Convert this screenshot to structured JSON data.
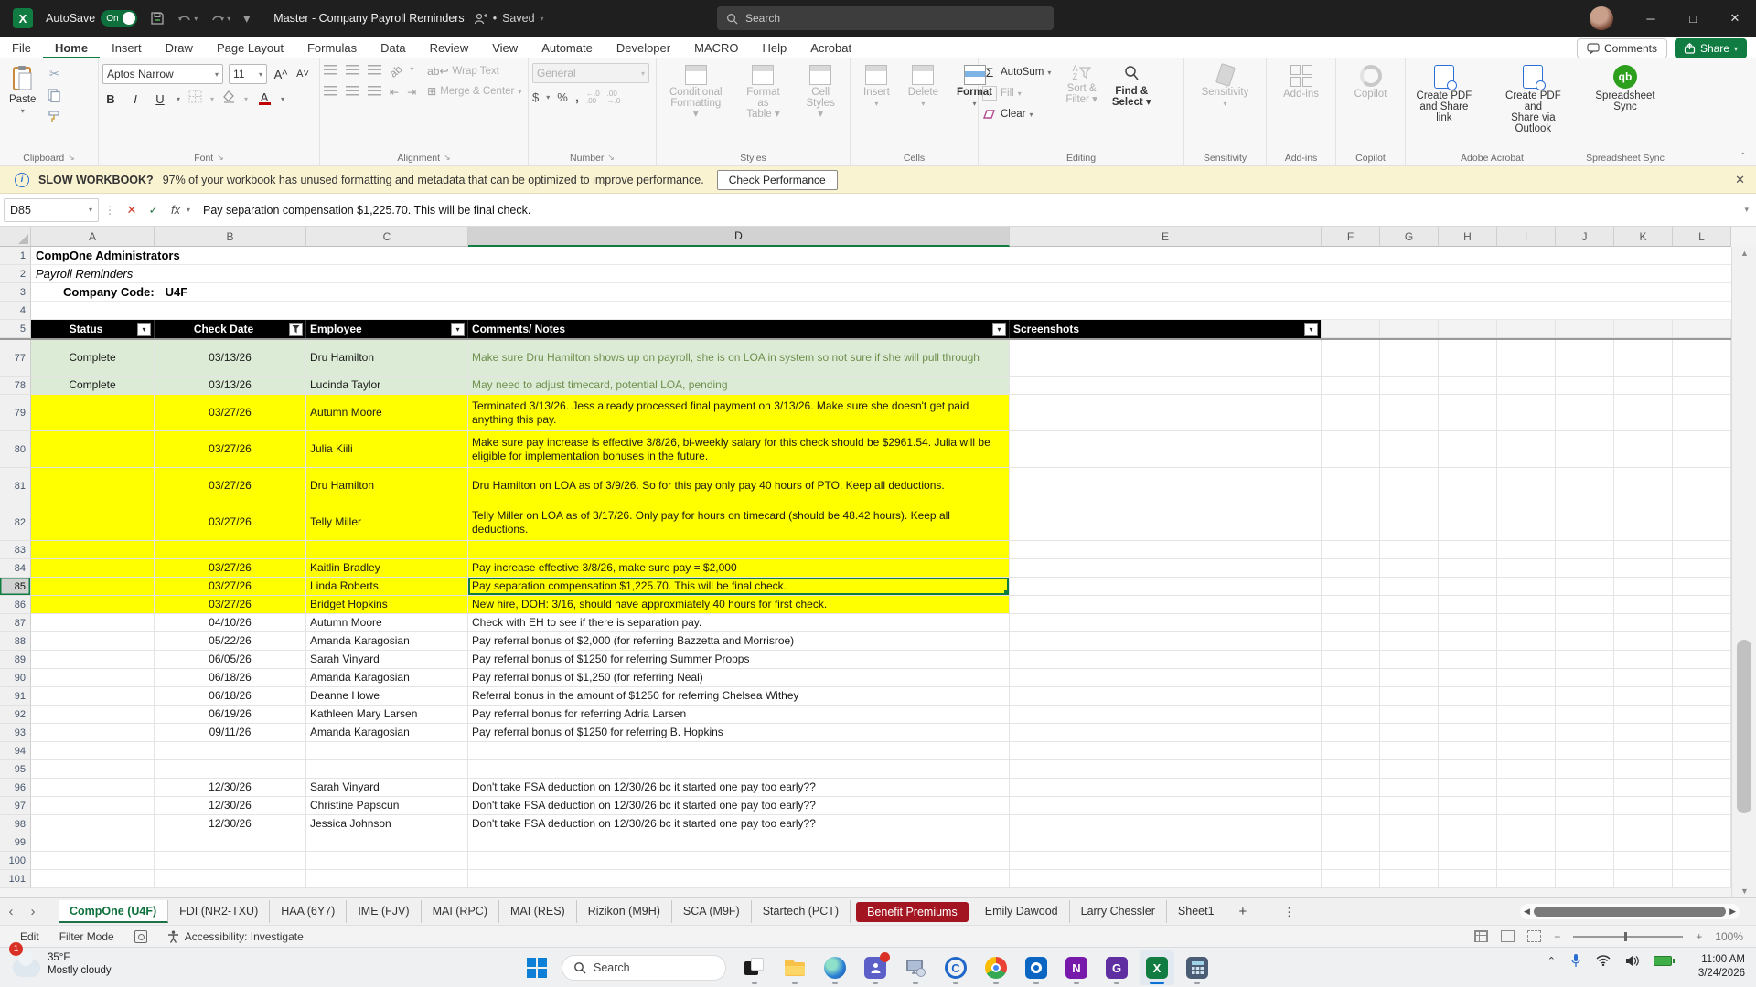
{
  "colors": {
    "accent_green": "#107C41",
    "header_black": "#000000",
    "row_green": "#DCEBD5",
    "row_yellow": "#FFFF00",
    "tab_red": "#A31621",
    "warning_bg": "#FAF3D1",
    "taskbar_accent": "#0a6fd4"
  },
  "titlebar": {
    "autosave": "AutoSave",
    "autosave_state": "On",
    "title": "Master - Company Payroll Reminders",
    "saved": "Saved",
    "search_placeholder": "Search",
    "window_buttons": {
      "minimize": "─",
      "maximize": "□",
      "close": "✕"
    }
  },
  "ribbon": {
    "tabs": [
      "File",
      "Home",
      "Insert",
      "Draw",
      "Page Layout",
      "Formulas",
      "Data",
      "Review",
      "View",
      "Automate",
      "Developer",
      "MACRO",
      "Help",
      "Acrobat"
    ],
    "active_tab": "Home",
    "comments": "Comments",
    "share": "Share",
    "clipboard": {
      "label": "Clipboard",
      "paste": "Paste"
    },
    "font": {
      "label": "Font",
      "name": "Aptos Narrow",
      "size": "11"
    },
    "alignment": {
      "label": "Alignment",
      "wrap": "Wrap Text",
      "merge": "Merge & Center"
    },
    "number": {
      "label": "Number",
      "format": "General"
    },
    "styles": {
      "label": "Styles",
      "conditional": "Conditional Formatting",
      "format_table": "Format as Table",
      "cell_styles": "Cell Styles"
    },
    "cells": {
      "label": "Cells",
      "insert": "Insert",
      "delete": "Delete",
      "format": "Format"
    },
    "editing": {
      "label": "Editing",
      "autosum": "AutoSum",
      "fill": "Fill",
      "clear": "Clear",
      "sort": "Sort & Filter",
      "find": "Find & Select"
    },
    "sensitivity": {
      "label": "Sensitivity",
      "button": "Sensitivity"
    },
    "addins": {
      "label": "Add-ins",
      "button": "Add-ins"
    },
    "copilot": {
      "label": "Copilot",
      "button": "Copilot"
    },
    "acrobat": {
      "label": "Adobe Acrobat",
      "pdf_link": "Create PDF and Share link",
      "pdf_outlook": "Create PDF and Share via Outlook"
    },
    "sync": {
      "label": "Spreadsheet Sync",
      "button": "Spreadsheet Sync",
      "logo": "qb"
    }
  },
  "warning": {
    "title": "SLOW WORKBOOK?",
    "message": "97% of your workbook has unused formatting and metadata that can be optimized to improve performance.",
    "action": "Check Performance"
  },
  "formula_bar": {
    "cell_ref": "D85",
    "value": "Pay separation compensation $1,225.70. This will be final check."
  },
  "grid": {
    "columns": [
      "A",
      "B",
      "C",
      "D",
      "E",
      "F",
      "G",
      "H",
      "I",
      "J",
      "K",
      "L"
    ],
    "selected_column": "D",
    "selected_cell": "D85",
    "info": {
      "row1": "CompOne Administrators",
      "row2": "Payroll Reminders",
      "row3_label": "Company Code:",
      "row3_value": "U4F"
    },
    "header": {
      "row": "5",
      "status": "Status",
      "date": "Check Date",
      "employee": "Employee",
      "comments": "Comments/ Notes",
      "screenshots": "Screenshots"
    },
    "rows": [
      {
        "n": 77,
        "h": 2,
        "bg": "g",
        "s": "Complete",
        "d": "03/13/26",
        "e": "Dru Hamilton",
        "c": "Make sure Dru Hamilton shows up on payroll, she is on LOA in system so not sure if she will pull through"
      },
      {
        "n": 78,
        "h": 1,
        "bg": "g",
        "s": "Complete",
        "d": "03/13/26",
        "e": "Lucinda Taylor",
        "c": "May need to adjust timecard, potential LOA, pending"
      },
      {
        "n": 79,
        "h": 2,
        "bg": "y",
        "s": "",
        "d": "03/27/26",
        "e": "Autumn Moore",
        "c": "Terminated 3/13/26. Jess already processed final payment on 3/13/26. Make sure she doesn't get paid anything this pay."
      },
      {
        "n": 80,
        "h": 2,
        "bg": "y",
        "s": "",
        "d": "03/27/26",
        "e": "Julia Kiili",
        "c": "Make sure pay increase is effective 3/8/26, bi-weekly salary for this check should be $2961.54. Julia will be eligible for implementation bonuses in the future."
      },
      {
        "n": 81,
        "h": 2,
        "bg": "y",
        "s": "",
        "d": "03/27/26",
        "e": "Dru Hamilton",
        "c": "Dru Hamilton on LOA as of 3/9/26. So for this pay only pay 40 hours of PTO. Keep all deductions."
      },
      {
        "n": 82,
        "h": 2,
        "bg": "y",
        "s": "",
        "d": "03/27/26",
        "e": "Telly Miller",
        "c": "Telly Miller on LOA as of 3/17/26. Only pay for hours on timecard (should be 48.42 hours). Keep all deductions."
      },
      {
        "n": 83,
        "h": 1,
        "bg": "y",
        "s": "",
        "d": "",
        "e": "",
        "c": ""
      },
      {
        "n": 84,
        "h": 1,
        "bg": "y",
        "s": "",
        "d": "03/27/26",
        "e": "Kaitlin Bradley",
        "c": "Pay increase effective 3/8/26, make sure pay = $2,000"
      },
      {
        "n": 85,
        "h": 1,
        "bg": "y",
        "s": "",
        "d": "03/27/26",
        "e": "Linda Roberts",
        "c": "Pay separation compensation $1,225.70. This will be final check.",
        "sel": true
      },
      {
        "n": 86,
        "h": 1,
        "bg": "y",
        "s": "",
        "d": "03/27/26",
        "e": "Bridget Hopkins",
        "c": "New hire, DOH: 3/16, should have approxmiately 40 hours for first check."
      },
      {
        "n": 87,
        "h": 1,
        "bg": "w",
        "s": "",
        "d": "04/10/26",
        "e": "Autumn Moore",
        "c": "Check with EH to see if there is separation pay."
      },
      {
        "n": 88,
        "h": 1,
        "bg": "w",
        "s": "",
        "d": "05/22/26",
        "e": "Amanda Karagosian",
        "c": "Pay referral bonus of $2,000 (for referring Bazzetta and Morrisroe)"
      },
      {
        "n": 89,
        "h": 1,
        "bg": "w",
        "s": "",
        "d": "06/05/26",
        "e": "Sarah Vinyard",
        "c": "Pay referral bonus of $1250 for referring Summer Propps"
      },
      {
        "n": 90,
        "h": 1,
        "bg": "w",
        "s": "",
        "d": "06/18/26",
        "e": "Amanda Karagosian",
        "c": "Pay referral bonus of $1,250 (for referring Neal)"
      },
      {
        "n": 91,
        "h": 1,
        "bg": "w",
        "s": "",
        "d": "06/18/26",
        "e": "Deanne Howe",
        "c": "Referral bonus in the amount of $1250 for referring Chelsea Withey"
      },
      {
        "n": 92,
        "h": 1,
        "bg": "w",
        "s": "",
        "d": "06/19/26",
        "e": "Kathleen Mary Larsen",
        "c": "Pay referral bonus for referring Adria Larsen"
      },
      {
        "n": 93,
        "h": 1,
        "bg": "w",
        "s": "",
        "d": "09/11/26",
        "e": "Amanda Karagosian",
        "c": "Pay referral bonus of $1250 for referring B. Hopkins"
      },
      {
        "n": 94,
        "h": 1,
        "bg": "w",
        "s": "",
        "d": "",
        "e": "",
        "c": ""
      },
      {
        "n": 95,
        "h": 1,
        "bg": "w",
        "s": "",
        "d": "",
        "e": "",
        "c": ""
      },
      {
        "n": 96,
        "h": 1,
        "bg": "w",
        "s": "",
        "d": "12/30/26",
        "e": "Sarah Vinyard",
        "c": "Don't take FSA deduction on 12/30/26 bc it started one pay too early??"
      },
      {
        "n": 97,
        "h": 1,
        "bg": "w",
        "s": "",
        "d": "12/30/26",
        "e": "Christine Papscun",
        "c": "Don't take FSA deduction on 12/30/26 bc it started one pay too early??"
      },
      {
        "n": 98,
        "h": 1,
        "bg": "w",
        "s": "",
        "d": "12/30/26",
        "e": "Jessica Johnson",
        "c": "Don't take FSA deduction on 12/30/26 bc it started one pay too early??"
      },
      {
        "n": 99,
        "h": 1,
        "bg": "w",
        "s": "",
        "d": "",
        "e": "",
        "c": ""
      },
      {
        "n": 100,
        "h": 1,
        "bg": "w",
        "s": "",
        "d": "",
        "e": "",
        "c": ""
      },
      {
        "n": 101,
        "h": 1,
        "bg": "w",
        "s": "",
        "d": "",
        "e": "",
        "c": ""
      }
    ]
  },
  "sheet_tabs": {
    "tabs": [
      {
        "label": "CompOne (U4F)",
        "style": "active"
      },
      {
        "label": "FDI (NR2-TXU)",
        "style": ""
      },
      {
        "label": "HAA (6Y7)",
        "style": ""
      },
      {
        "label": "IME (FJV)",
        "style": ""
      },
      {
        "label": "MAI (RPC)",
        "style": ""
      },
      {
        "label": "MAI (RES)",
        "style": ""
      },
      {
        "label": "Rizikon (M9H)",
        "style": ""
      },
      {
        "label": "SCA (M9F)",
        "style": ""
      },
      {
        "label": "Startech (PCT)",
        "style": ""
      },
      {
        "label": "Benefit Premiums",
        "style": "red"
      },
      {
        "label": "Emily Dawood",
        "style": ""
      },
      {
        "label": "Larry Chessler",
        "style": ""
      },
      {
        "label": "Sheet1",
        "style": ""
      }
    ]
  },
  "status_bar": {
    "mode": "Edit",
    "filter": "Filter Mode",
    "accessibility": "Accessibility: Investigate",
    "zoom": "100%"
  },
  "taskbar": {
    "badge": "1",
    "temp": "35°F",
    "condition": "Mostly cloudy",
    "search": "Search",
    "icons": [
      "task-view",
      "explorer",
      "edge",
      "teams",
      "remote-desktop",
      "c-app",
      "chrome",
      "outlook",
      "onenote",
      "goto",
      "excel",
      "calculator"
    ],
    "active_icon": "excel",
    "time": "11:00 AM",
    "date": "3/24/2026"
  }
}
